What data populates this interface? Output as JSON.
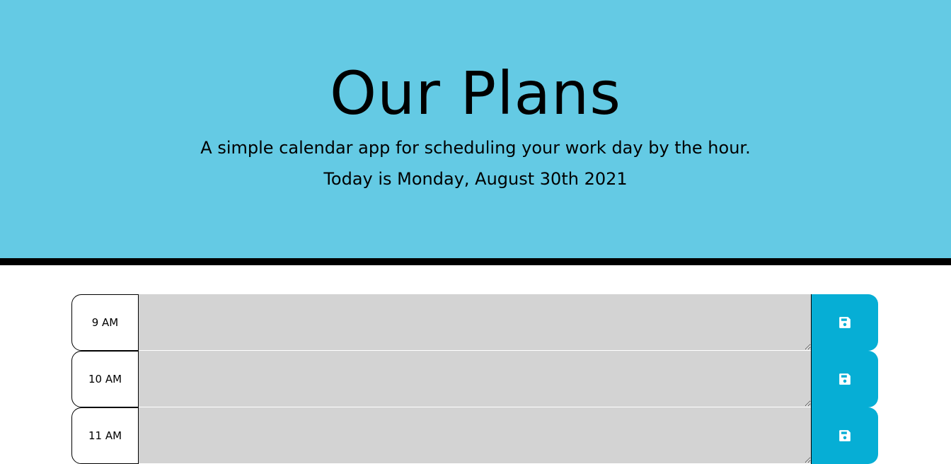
{
  "header": {
    "title": "Our Plans",
    "lead": "A simple calendar app for scheduling your work day by the hour.",
    "current_day": "Today is Monday, August 30th 2021"
  },
  "colors": {
    "header_bg": "#64cae4",
    "past_block": "#d3d3d3",
    "save_button": "#06aed5"
  },
  "time_blocks": [
    {
      "hour": "9 AM",
      "text": "",
      "save_icon": "floppy-disk-icon"
    },
    {
      "hour": "10 AM",
      "text": "",
      "save_icon": "floppy-disk-icon"
    },
    {
      "hour": "11 AM",
      "text": "",
      "save_icon": "floppy-disk-icon"
    }
  ]
}
